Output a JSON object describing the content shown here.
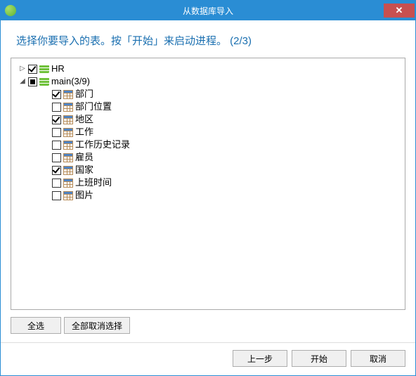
{
  "window": {
    "title": "从数据库导入"
  },
  "instruction": "选择你要导入的表。按「开始」来启动进程。  (2/3)",
  "tree": {
    "databases": [
      {
        "name": "HR",
        "checked": "checked",
        "expanded": false,
        "count_suffix": "",
        "tables": []
      },
      {
        "name": "main",
        "checked": "partial",
        "expanded": true,
        "count_suffix": " (3/9)",
        "tables": [
          {
            "name": "部门",
            "checked": true
          },
          {
            "name": "部门位置",
            "checked": false
          },
          {
            "name": "地区",
            "checked": true
          },
          {
            "name": "工作",
            "checked": false
          },
          {
            "name": "工作历史记录",
            "checked": false
          },
          {
            "name": "雇员",
            "checked": false
          },
          {
            "name": "国家",
            "checked": true
          },
          {
            "name": "上班时间",
            "checked": false
          },
          {
            "name": "图片",
            "checked": false
          }
        ]
      }
    ]
  },
  "buttons": {
    "select_all": "全选",
    "deselect_all": "全部取消选择",
    "prev": "上一步",
    "start": "开始",
    "cancel": "取消"
  }
}
